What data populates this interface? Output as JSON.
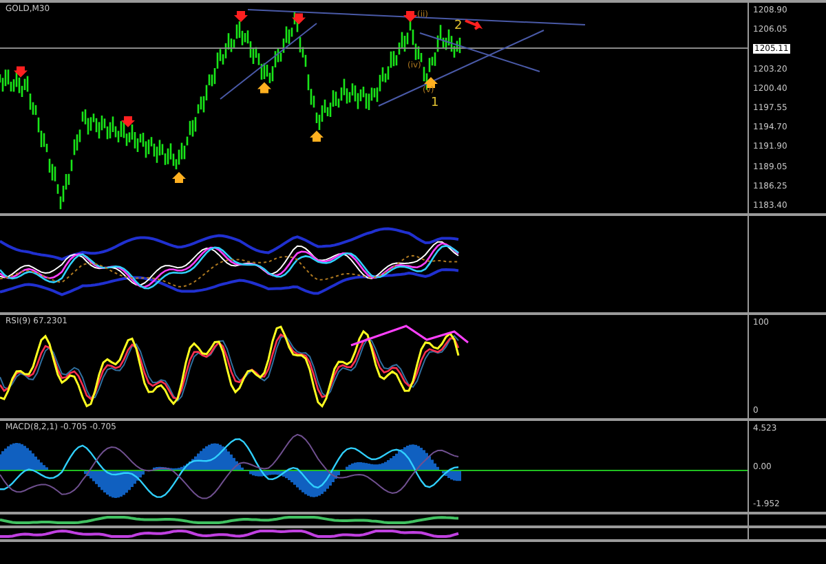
{
  "main_chart": {
    "symbol": "GOLD,M30",
    "price_axis": [
      {
        "text": "1208.90",
        "kind": "tick"
      },
      {
        "text": "1206.05",
        "kind": "tick"
      },
      {
        "text": "1205.11",
        "kind": "current"
      },
      {
        "text": "1203.20",
        "kind": "tick"
      },
      {
        "text": "1200.40",
        "kind": "tick"
      },
      {
        "text": "1197.55",
        "kind": "tick"
      },
      {
        "text": "1194.70",
        "kind": "tick"
      },
      {
        "text": "1191.90",
        "kind": "tick"
      },
      {
        "text": "1189.05",
        "kind": "tick"
      },
      {
        "text": "1186.25",
        "kind": "tick"
      },
      {
        "text": "1183.40",
        "kind": "tick"
      }
    ],
    "wave_labels": [
      {
        "text": "(ii)",
        "kind": "minor"
      },
      {
        "text": "2",
        "kind": "major"
      },
      {
        "text": "(iv)",
        "kind": "minor"
      },
      {
        "text": "(v)",
        "kind": "minor"
      },
      {
        "text": "1",
        "kind": "major"
      }
    ]
  },
  "rsi_pane": {
    "label": "RSI(9) 67.2301",
    "axis": [
      "100",
      "0"
    ]
  },
  "macd_pane": {
    "label": "MACD(8,2,1) -0.705 -0.705",
    "axis": [
      "4.523",
      "0.00",
      "-1.952"
    ]
  }
}
